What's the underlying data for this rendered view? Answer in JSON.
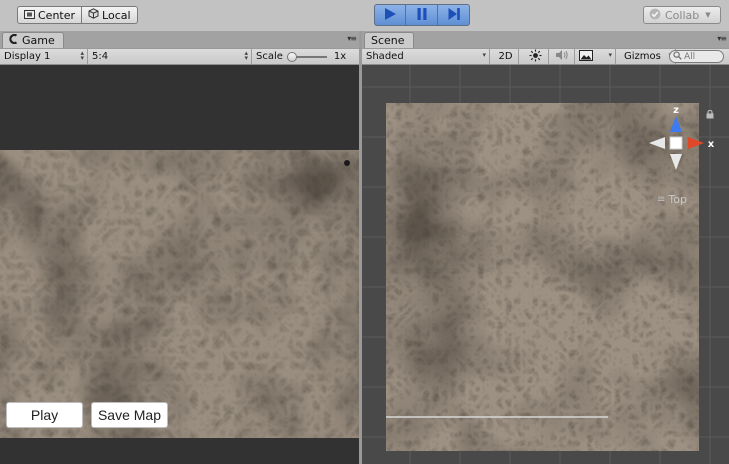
{
  "toolbar": {
    "pivot_center_label": "Center",
    "pivot_local_label": "Local",
    "collab_label": "Collab"
  },
  "game_panel": {
    "tab_label": "Game",
    "display_label": "Display 1",
    "aspect_label": "5:4",
    "scale_label": "Scale",
    "scale_value": "1x",
    "play_button_label": "Play",
    "save_map_button_label": "Save Map"
  },
  "scene_panel": {
    "tab_label": "Scene",
    "shading_label": "Shaded",
    "mode_2d_label": "2D",
    "gizmos_label": "Gizmos",
    "search_placeholder": "All",
    "axis_z": "z",
    "axis_x": "x",
    "view_label": "Top"
  },
  "colors": {
    "play_active": "#6a97da",
    "axis_x": "#e0482a",
    "axis_z": "#3d7bf0",
    "terrain": "#9c8e7e"
  }
}
